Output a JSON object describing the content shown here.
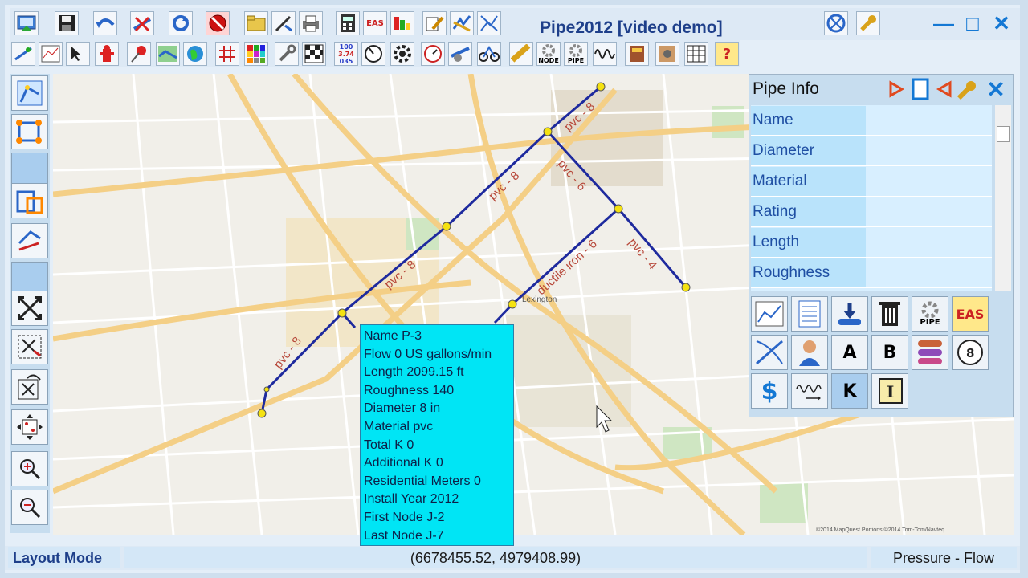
{
  "window": {
    "title": "Pipe2012  [video demo]",
    "minimize_glyph": "—",
    "maximize_glyph": "□",
    "close_glyph": "✕"
  },
  "toolbar2": {
    "table_numbers": [
      "100",
      "3.74",
      "035"
    ],
    "node_label": "NODE",
    "pipe_label": "PIPE",
    "help_glyph": "?"
  },
  "pipe_info": {
    "title": "Pipe Info",
    "rows": [
      "Name",
      "Diameter",
      "Material",
      "Rating",
      "Length",
      "Roughness"
    ],
    "buttons": {
      "pipe_label": "PIPE",
      "eas_label": "EAS",
      "a_label": "A",
      "b_label": "B",
      "dollar_label": "$",
      "k_label": "K",
      "i_label": "I"
    }
  },
  "map": {
    "pipe_labels": [
      "pvc - 8",
      "pvc - 8",
      "pvc - 8",
      "pvc - 8",
      "pvc - 6",
      "ductile iron - 6",
      "pvc - 4"
    ],
    "town_label": "Lexington",
    "copyright": "©2014 MapQuest Portions ©2014 Tom-Tom/Navteq"
  },
  "tooltip": {
    "lines": [
      "Name  P-3",
      "Flow  0 US gallons/min",
      "Length  2099.15 ft",
      "Roughness  140",
      "Diameter  8 in",
      "Material  pvc",
      "Total K  0",
      "Additional K  0",
      "Residential Meters  0",
      "Install Year  2012",
      "First Node  J-2",
      "Last Node  J-7"
    ]
  },
  "status": {
    "mode": "Layout Mode",
    "coords": "(6678455.52, 4979408.99)",
    "right": "Pressure  -  Flow"
  },
  "colors": {
    "pipe": "#1e2a9e",
    "node": "#f5e211",
    "tooltip_bg": "#00e5f5",
    "title_text": "#1e3f8a"
  }
}
